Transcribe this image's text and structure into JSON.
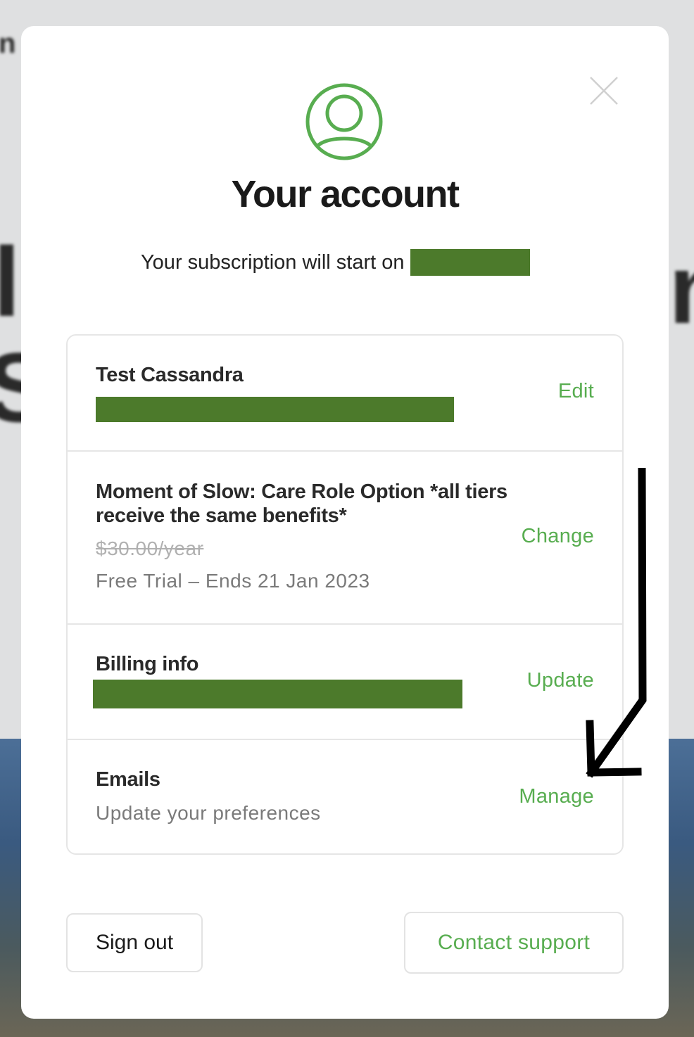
{
  "modal": {
    "title": "Your account",
    "subtitle": "Your subscription will start on"
  },
  "profile": {
    "name": "Test Cassandra",
    "action": "Edit"
  },
  "plan": {
    "name": "Moment of Slow: Care Role Option *all tiers receive the same benefits*",
    "price": "$30.00/year",
    "status": "Free Trial – Ends 21 Jan 2023",
    "action": "Change"
  },
  "billing": {
    "heading": "Billing info",
    "action": "Update"
  },
  "emails": {
    "heading": "Emails",
    "description": "Update your preferences",
    "action": "Manage"
  },
  "footer": {
    "sign_out": "Sign out",
    "contact_support": "Contact support"
  },
  "colors": {
    "accent": "#58ad50",
    "redaction": "#4c7a2b",
    "annotation": "#000000"
  },
  "icons": {
    "avatar": "user-circle-icon",
    "close": "close-icon",
    "annotation": "down-arrow-annotation"
  }
}
